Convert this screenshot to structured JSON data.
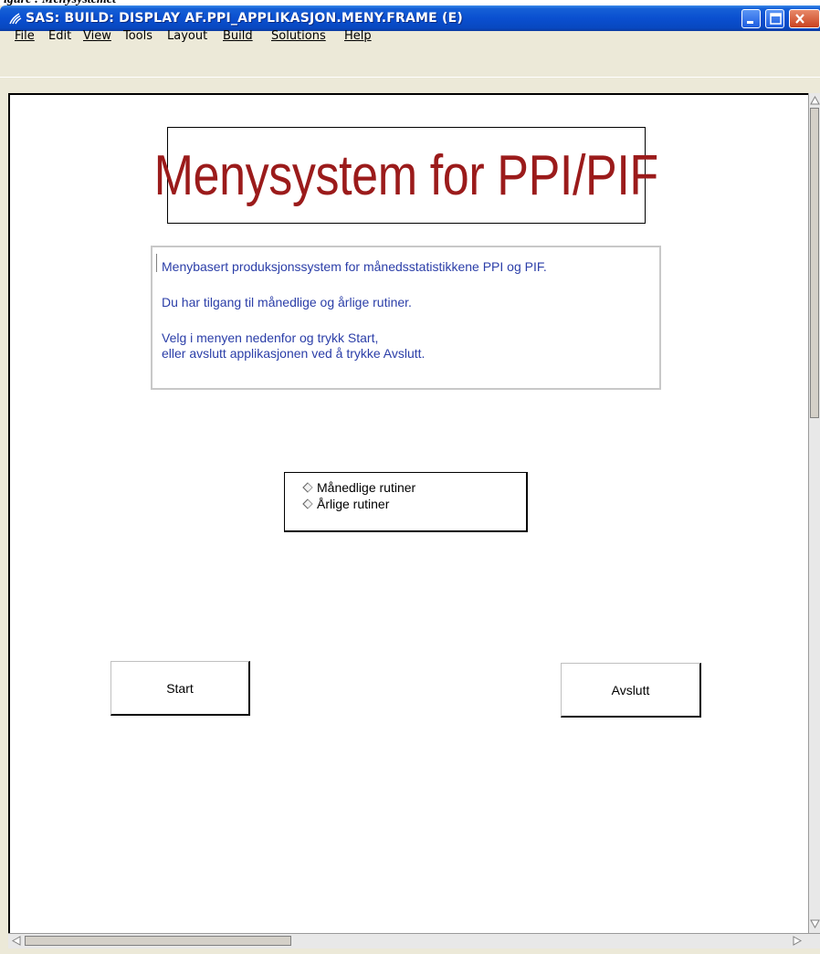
{
  "caption": "igure    : Menysystemet",
  "window": {
    "title": "SAS: BUILD: DISPLAY AF.PPI_APPLIKASJON.MENY.FRAME (E)"
  },
  "menu": [
    {
      "label": "File"
    },
    {
      "label": "Edit"
    },
    {
      "label": "View"
    },
    {
      "label": "Tools"
    },
    {
      "label": "Layout"
    },
    {
      "label": "Build"
    },
    {
      "label": "Solutions"
    },
    {
      "label": "Help"
    }
  ],
  "banner": {
    "title": "Menysystem for PPI/PIF"
  },
  "info": {
    "line1": "Menybasert produksjonssystem for månedsstatistikkene PPI og PIF.",
    "line2": "Du har tilgang til månedlige og årlige rutiner.",
    "line3": "Velg i menyen nedenfor og trykk Start,",
    "line4": "eller avslutt applikasjonen ved å trykke Avslutt."
  },
  "options": [
    {
      "label": "Månedlige rutiner"
    },
    {
      "label": "Årlige rutiner"
    }
  ],
  "buttons": {
    "start": "Start",
    "exit": "Avslutt"
  },
  "colors": {
    "banner_text": "#9b1b1b",
    "info_text": "#2b3ea8",
    "titlebar": "#0a4fd0"
  }
}
